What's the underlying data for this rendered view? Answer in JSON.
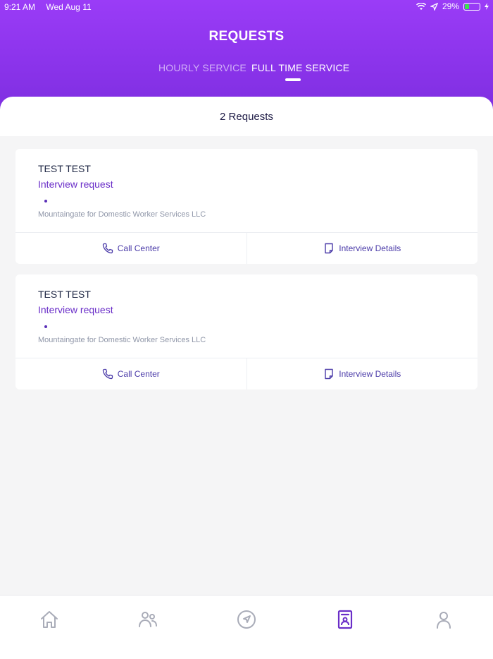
{
  "status_bar": {
    "time": "9:21 AM",
    "date": "Wed Aug 11",
    "battery": "29%"
  },
  "header": {
    "title": "REQUESTS"
  },
  "tabs": [
    {
      "label": "HOURLY SERVICE"
    },
    {
      "label": "FULL TIME SERVICE"
    }
  ],
  "summary": {
    "count_text": "2 Requests"
  },
  "requests": [
    {
      "name": "TEST TEST",
      "type": "Interview request",
      "company": "Mountaingate for Domestic Worker Services LLC",
      "call_label": "Call Center",
      "details_label": "Interview Details"
    },
    {
      "name": "TEST TEST",
      "type": "Interview request",
      "company": "Mountaingate for Domestic Worker Services LLC",
      "call_label": "Call Center",
      "details_label": "Interview Details"
    }
  ],
  "bottom_nav": [
    {
      "icon": "home-icon"
    },
    {
      "icon": "people-icon"
    },
    {
      "icon": "navigation-icon"
    },
    {
      "icon": "requests-icon"
    },
    {
      "icon": "profile-icon"
    }
  ],
  "colors": {
    "header": "#8a33ea",
    "accent": "#6a2ec8",
    "battery_fill": "#3be34a",
    "background": "#f5f5f6"
  }
}
